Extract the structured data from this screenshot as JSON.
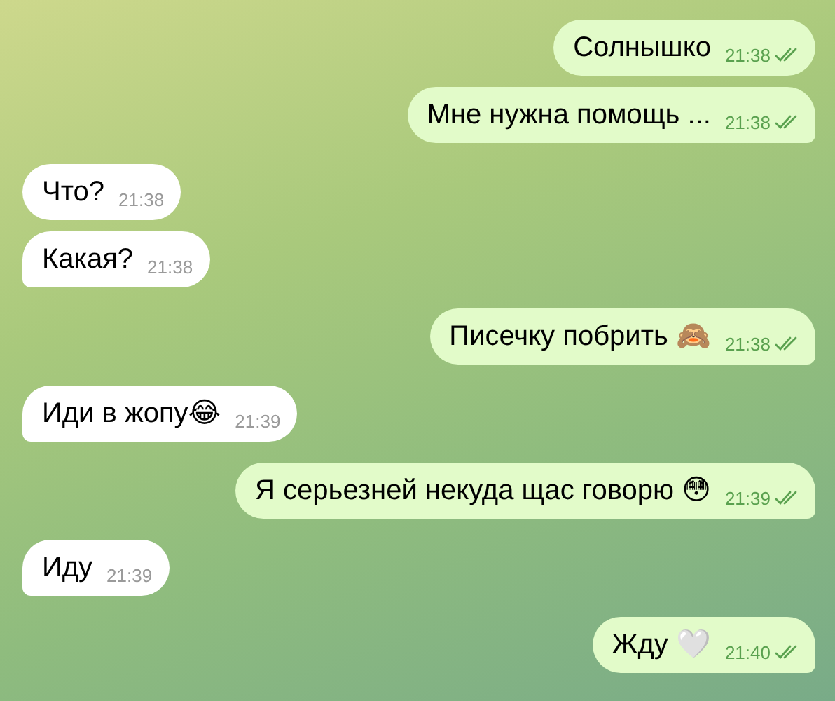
{
  "messages": [
    {
      "kind": "outgoing",
      "text": "Солнышко",
      "time": "21:38",
      "read": true
    },
    {
      "kind": "outgoing",
      "text": "Мне нужна помощь ...",
      "time": "21:38",
      "read": true
    },
    {
      "kind": "incoming",
      "text": "Что?",
      "time": "21:38"
    },
    {
      "kind": "incoming",
      "text": "Какая?",
      "time": "21:38"
    },
    {
      "kind": "outgoing",
      "text": "Писечку побрить 🙈",
      "time": "21:38",
      "read": true
    },
    {
      "kind": "incoming",
      "text": "Иди в жопу😂",
      "time": "21:39"
    },
    {
      "kind": "outgoing",
      "text": "Я серьезней некуда щас говорю 😳",
      "time": "21:39",
      "read": true
    },
    {
      "kind": "incoming",
      "text": "Иду",
      "time": "21:39"
    },
    {
      "kind": "outgoing",
      "text": "Жду 🤍",
      "time": "21:40",
      "read": true
    }
  ]
}
